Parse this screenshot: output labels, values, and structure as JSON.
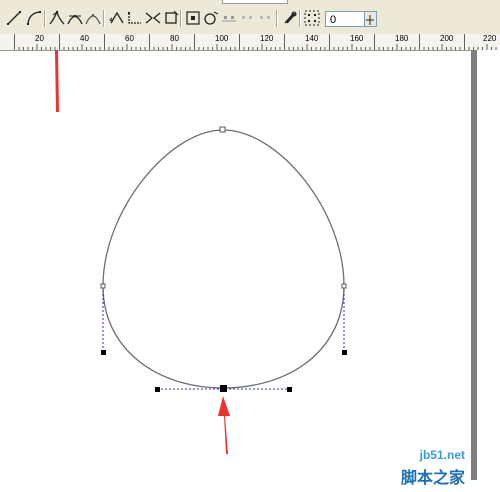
{
  "toolbar": {
    "buttons": [
      {
        "name": "line-to-icon"
      },
      {
        "name": "curve-to-icon"
      },
      {
        "name": "cusp-node-icon"
      },
      {
        "name": "smooth-node-icon"
      },
      {
        "name": "symmetric-node-icon"
      },
      {
        "name": "reverse-direction-icon"
      },
      {
        "name": "extend-curve-icon"
      },
      {
        "name": "extract-subpath-icon"
      },
      {
        "name": "auto-close-icon"
      },
      {
        "name": "stretch-scale-nodes-icon"
      },
      {
        "name": "rotate-skew-nodes-icon"
      },
      {
        "name": "align-nodes-icon"
      },
      {
        "name": "elastic-mode-icon"
      },
      {
        "name": "select-all-nodes-icon"
      }
    ],
    "curve_smoothness_value": "0"
  },
  "ruler": {
    "labels": [
      "20",
      "40",
      "60",
      "80",
      "100",
      "120",
      "140",
      "160",
      "180",
      "200",
      "220"
    ]
  },
  "watermark": {
    "domain": "jb51.net",
    "name": "脚本之家"
  },
  "colors": {
    "toolbar_bg": "#ece9d8",
    "curve": "#6b6b7a",
    "handle_line": "#2a2ad0",
    "arrow": "#e8352f"
  }
}
